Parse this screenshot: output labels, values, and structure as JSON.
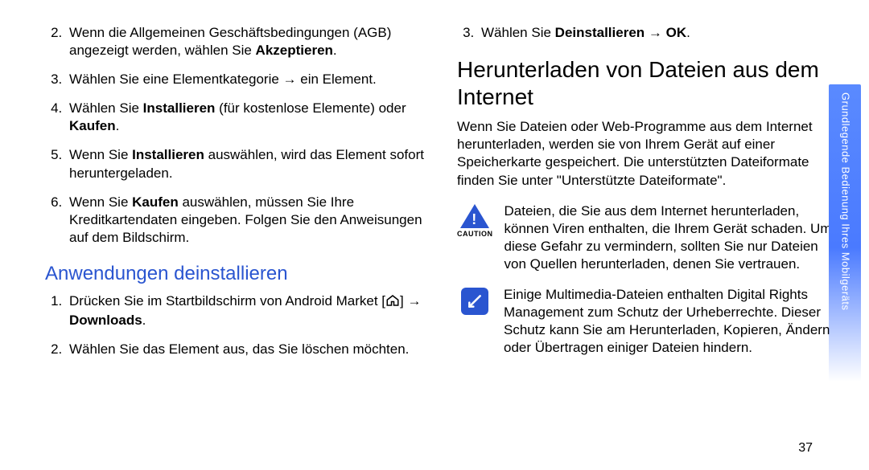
{
  "tab_label": "Grundlegende Bedienung Ihres Mobilgeräts",
  "page_number": "37",
  "left": {
    "steps_main": [
      {
        "pre": "Wenn die Allgemeinen Geschäftsbedingungen (AGB) angezeigt werden, wählen Sie ",
        "bold": "Akzeptieren",
        "post": "."
      },
      {
        "pre": "Wählen Sie eine Elementkategorie → ein Element.",
        "bold": "",
        "post": ""
      },
      {
        "pre": "Wählen Sie ",
        "bold": "Installieren",
        "mid": " (für kostenlose Elemente) oder ",
        "bold2": "Kaufen",
        "post": "."
      },
      {
        "pre": "Wenn Sie ",
        "bold": "Installieren",
        "post": " auswählen, wird das Element sofort heruntergeladen."
      },
      {
        "pre": "Wenn Sie ",
        "bold": "Kaufen",
        "post": " auswählen, müssen Sie Ihre Kreditkartendaten eingeben. Folgen Sie den Anweisungen auf dem Bildschirm."
      }
    ],
    "sub_heading": "Anwendungen deinstallieren",
    "steps_uninstall": [
      {
        "pre": "Drücken Sie im Startbildschirm von Android Market [",
        "icon": true,
        "mid": "] → ",
        "bold": "Downloads",
        "post": "."
      },
      {
        "pre": "Wählen Sie das Element aus, das Sie löschen möchten.",
        "bold": "",
        "post": ""
      }
    ]
  },
  "right": {
    "step3": {
      "pre": "Wählen Sie ",
      "bold": "Deinstallieren",
      "mid": " → ",
      "bold2": "OK",
      "post": "."
    },
    "heading": "Herunterladen von Dateien aus dem Internet",
    "para": "Wenn Sie Dateien oder Web-Programme aus dem Internet herunterladen, werden sie von Ihrem Gerät auf einer Speicherkarte gespeichert. Die unterstützten Dateiformate finden Sie unter \"Unterstützte Dateiformate\".",
    "caution_label": "CAUTION",
    "caution_text": "Dateien, die Sie aus dem Internet herunterladen, können Viren enthalten, die Ihrem Gerät schaden. Um diese Gefahr zu vermindern, sollten Sie nur Dateien von Quellen herunterladen, denen Sie vertrauen.",
    "note_text": "Einige Multimedia-Dateien enthalten Digital Rights Management zum Schutz der Urheberrechte. Dieser Schutz kann Sie am Herunterladen, Kopieren, Ändern oder Übertragen einiger Dateien hindern."
  }
}
